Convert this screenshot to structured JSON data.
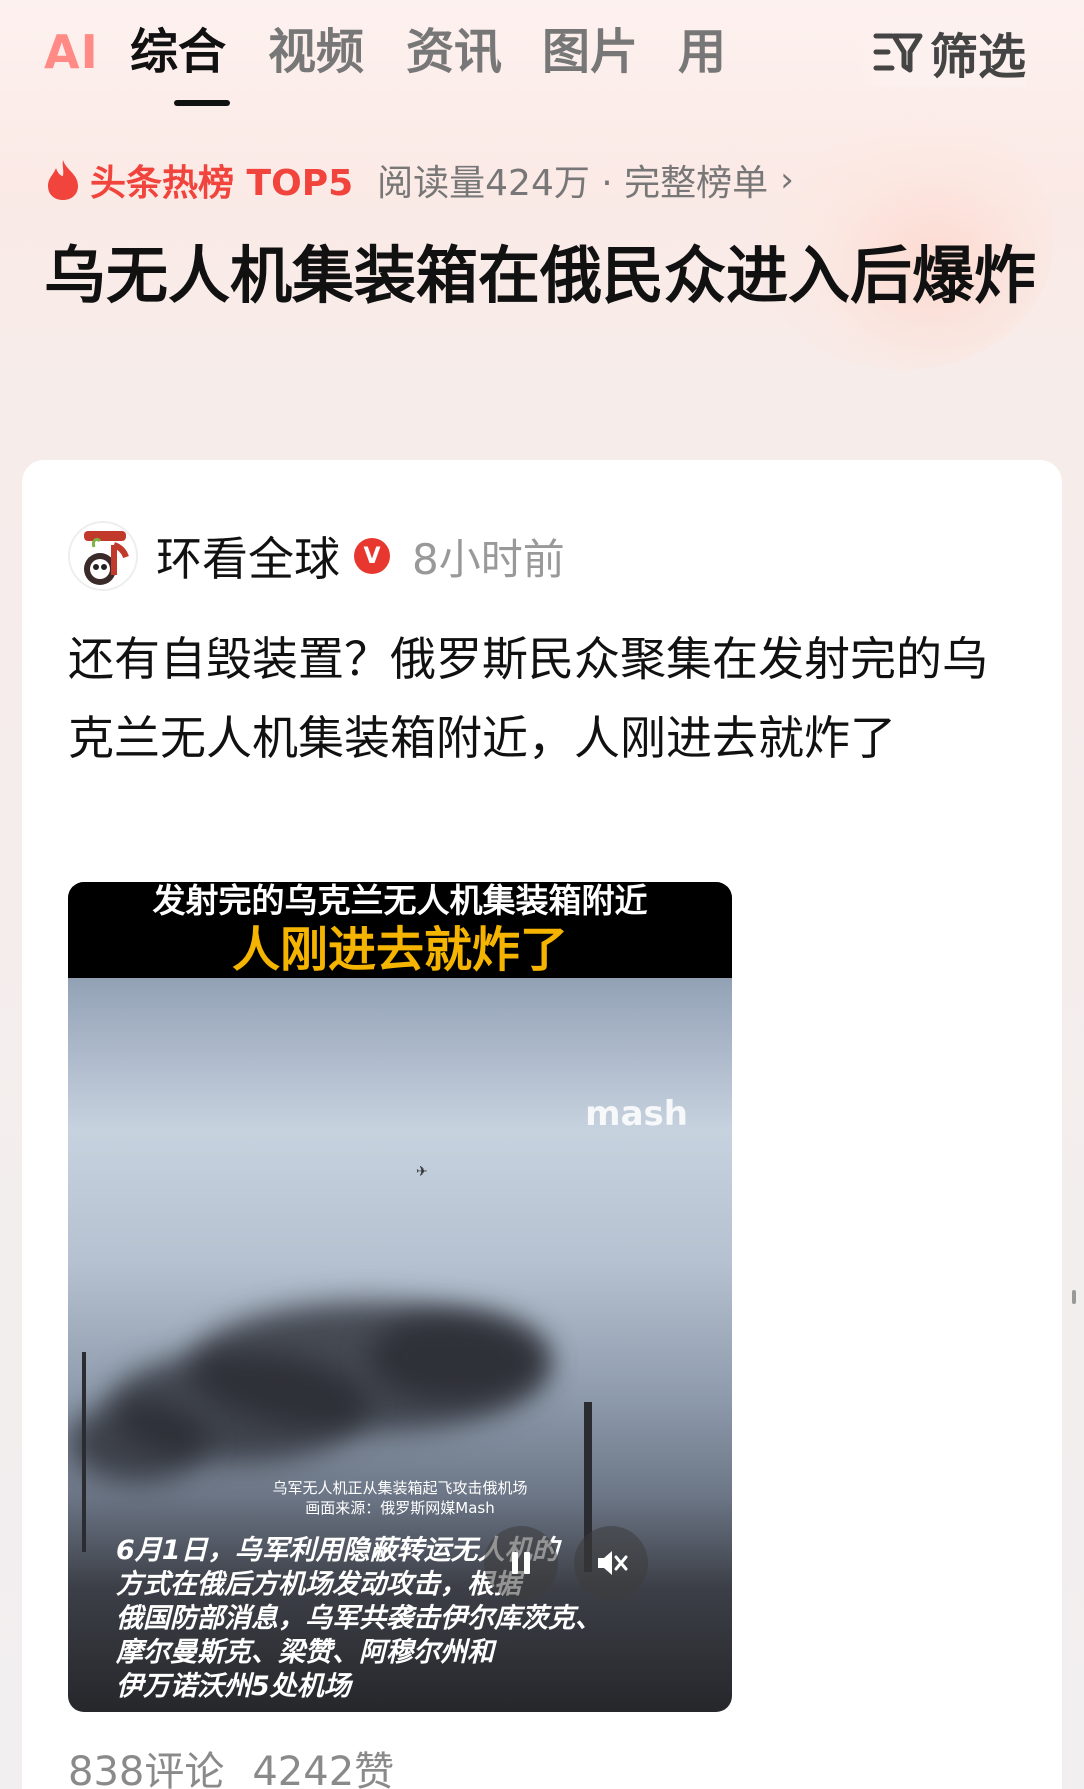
{
  "tabs": {
    "ai": "AI",
    "items": [
      "综合",
      "视频",
      "资讯",
      "图片",
      "用"
    ],
    "active": "综合",
    "filter_label": "筛选"
  },
  "hot": {
    "label": "头条热榜 TOP5",
    "meta": "阅读量424万 · 完整榜单"
  },
  "headline": "乌无人机集装箱在俄民众进入后爆炸",
  "post": {
    "author": "环看全球",
    "verified_badge": "V",
    "time": "8小时前",
    "text": "还有自毁装置？俄罗斯民众聚集在发射完的乌克兰无人机集装箱附近，人刚进去就炸了",
    "video": {
      "top_line1": "发射完的乌克兰无人机集装箱附近",
      "top_line2": "人刚进去就炸了",
      "watermark": "mash",
      "small_caption1": "乌军无人机正从集装箱起飞攻击俄机场",
      "small_caption2": "画面来源：俄罗斯网媒Mash",
      "caption_lines": [
        "6月1日，乌军利用隐蔽转运无人机的",
        "方式在俄后方机场发动攻击，根据",
        "俄国防部消息，乌军共袭击伊尔库茨克、",
        "摩尔曼斯克、梁赞、阿穆尔州和",
        "伊万诺沃州5处机场"
      ]
    },
    "comments": "838评论",
    "likes": "4242赞"
  },
  "colors": {
    "accent_red": "#f0443c",
    "ai_pink": "#ff8a86",
    "caption_yellow": "#f5b400"
  }
}
